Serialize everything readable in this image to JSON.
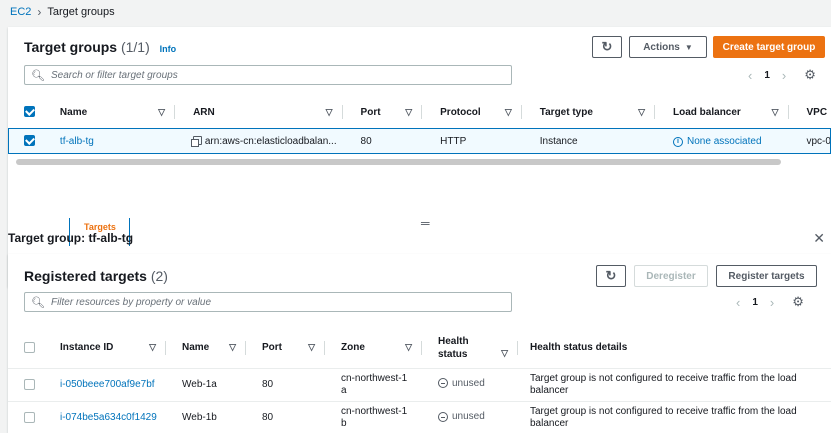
{
  "breadcrumb": {
    "root": "EC2",
    "current": "Target groups"
  },
  "target_groups": {
    "title": "Target groups",
    "count": "(1/1)",
    "info": "Info",
    "actions_label": "Actions",
    "create_label": "Create target group",
    "search_placeholder": "Search or filter target groups",
    "page": "1",
    "columns": [
      "Name",
      "ARN",
      "Port",
      "Protocol",
      "Target type",
      "Load balancer",
      "VPC"
    ],
    "rows": [
      {
        "name": "tf-alb-tg",
        "arn": "arn:aws-cn:elasticloadbalan...",
        "port": "80",
        "protocol": "HTTP",
        "target_type": "Instance",
        "load_balancer": "None associated",
        "vpc": "vpc-0"
      }
    ]
  },
  "details": {
    "tab_label": "Targets",
    "title": "Target group: tf-alb-tg"
  },
  "registered": {
    "title": "Registered targets",
    "count": "(2)",
    "deregister_label": "Deregister",
    "register_label": "Register targets",
    "search_placeholder": "Filter resources by property or value",
    "page": "1",
    "columns": [
      "Instance ID",
      "Name",
      "Port",
      "Zone",
      "Health status",
      "Health status details"
    ],
    "rows": [
      {
        "instance_id": "i-050beee700af9e7bf",
        "name": "Web-1a",
        "port": "80",
        "zone": "cn-northwest-1a",
        "health": "unused",
        "details": "Target group is not configured to receive traffic from the load balancer"
      },
      {
        "instance_id": "i-074be5a634c0f1429",
        "name": "Web-1b",
        "port": "80",
        "zone": "cn-northwest-1b",
        "health": "unused",
        "details": "Target group is not configured to receive traffic from the load balancer"
      }
    ]
  },
  "colors": {
    "link": "#0073bb",
    "primary": "#ec7211"
  }
}
